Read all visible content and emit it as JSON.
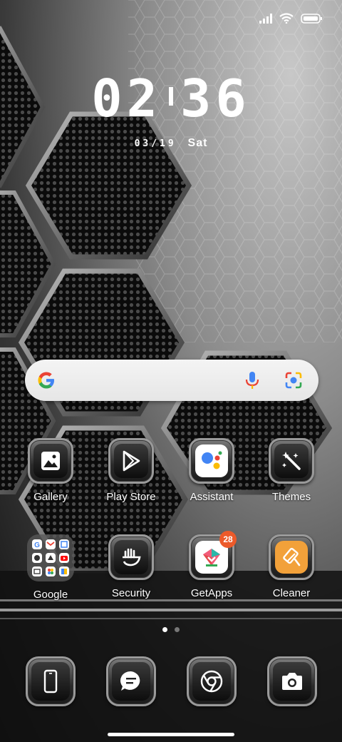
{
  "status_bar": {
    "icons": [
      "signal-icon",
      "wifi-icon",
      "battery-icon"
    ]
  },
  "clock": {
    "hours": "02",
    "minutes": "36"
  },
  "date": {
    "date": "03/19",
    "day": "Sat"
  },
  "search_bar": {
    "icons": [
      "google-logo-icon",
      "mic-icon",
      "lens-camera-icon"
    ]
  },
  "apps_row1": [
    {
      "label": "Gallery",
      "icon": "gallery-icon"
    },
    {
      "label": "Play Store",
      "icon": "play-store-icon"
    },
    {
      "label": "Assistant",
      "icon": "assistant-icon"
    },
    {
      "label": "Themes",
      "icon": "themes-icon"
    }
  ],
  "apps_row2": [
    {
      "label": "Google",
      "icon": "google-folder-icon"
    },
    {
      "label": "Security",
      "icon": "security-icon"
    },
    {
      "label": "GetApps",
      "icon": "getapps-icon",
      "badge": "28"
    },
    {
      "label": "Cleaner",
      "icon": "cleaner-icon"
    }
  ],
  "page_indicator": {
    "pages": 2,
    "current": 1
  },
  "dock": [
    {
      "icon": "phone-icon"
    },
    {
      "icon": "messages-icon"
    },
    {
      "icon": "chrome-icon"
    },
    {
      "icon": "camera-icon"
    }
  ],
  "colors": {
    "badge": "#ec5a2a",
    "accent_orange": "#f2a13a"
  }
}
